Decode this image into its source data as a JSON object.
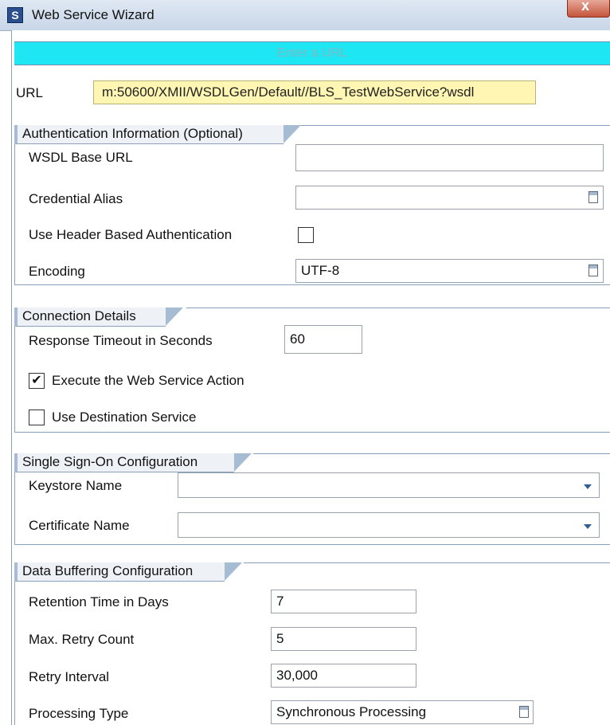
{
  "window": {
    "title": "Web Service Wizard",
    "close_glyph": "x"
  },
  "banner": {
    "text": "Enter a URL"
  },
  "url": {
    "label": "URL",
    "value": "m:50600/XMII/WSDLGen/Default//BLS_TestWebService?wsdl"
  },
  "auth": {
    "title": "Authentication Information (Optional)",
    "wsdl_base_url_label": "WSDL Base URL",
    "wsdl_base_url_value": "",
    "credential_alias_label": "Credential Alias",
    "credential_alias_value": "",
    "header_auth_label": "Use Header Based Authentication",
    "header_auth_checked": "",
    "encoding_label": "Encoding",
    "encoding_value": "UTF-8"
  },
  "connection": {
    "title": "Connection Details",
    "timeout_label": "Response Timeout in Seconds",
    "timeout_value": "60",
    "execute_label": "Execute the Web Service Action",
    "execute_checked": "✔",
    "destination_label": "Use Destination Service",
    "destination_checked": ""
  },
  "sso": {
    "title": "Single Sign-On Configuration",
    "keystore_label": "Keystore Name",
    "keystore_value": "",
    "certificate_label": "Certificate Name",
    "certificate_value": ""
  },
  "buffering": {
    "title": "Data Buffering Configuration",
    "retention_label": "Retention Time in Days",
    "retention_value": "7",
    "retry_count_label": "Max. Retry Count",
    "retry_count_value": "5",
    "retry_interval_label": "Retry Interval",
    "retry_interval_value": "30,000",
    "processing_label": "Processing Type",
    "processing_value": "Synchronous Processing"
  },
  "icons": {
    "app": "sap-app-icon",
    "close": "close-icon",
    "value_help": "value-help-icon",
    "dropdown": "chevron-down-icon",
    "checkbox": "checkbox"
  },
  "colors": {
    "banner": "#1ee6f2",
    "url_field": "#fff6b3",
    "group_border": "#8aa0b8",
    "titlebar": "#c8d6e8"
  }
}
